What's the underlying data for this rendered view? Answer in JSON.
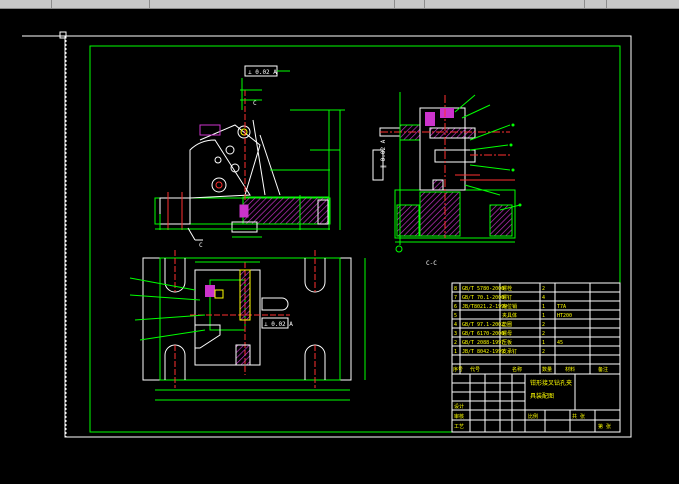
{
  "window": {
    "title_strip": "",
    "strip_colors": {
      "bg": "#c8c8c8",
      "divider": "#8c8c8c"
    }
  },
  "colors": {
    "background": "#000000",
    "border_green": "#00ff00",
    "white": "#ffffff",
    "red": "#ff3030",
    "yellow": "#ffff00",
    "magenta": "#cc33cc",
    "cyan": "#00ffff"
  },
  "drawing": {
    "section_label": "C-C",
    "view_marker": "C",
    "tag_top": "⊥ 0.02 A",
    "tag_side": "∥ 0.02 A",
    "tag_plan": "⊥ 0.02 A"
  },
  "bom": {
    "rows": [
      {
        "no": "8",
        "code": "GB/T 5780-2000",
        "name": "螺栓",
        "qty": "2"
      },
      {
        "no": "7",
        "code": "GB/T 70.1-2000",
        "name": "螺钉",
        "qty": "4"
      },
      {
        "no": "6",
        "code": "JB/T8021.2-1999",
        "name": "定位销",
        "qty": "1",
        "mat": "T7A"
      },
      {
        "no": "5",
        "code": "",
        "name": "夹具体",
        "qty": "1",
        "mat": "HT200"
      },
      {
        "no": "4",
        "code": "GB/T 97.1-2002",
        "name": "垫圈",
        "qty": "2"
      },
      {
        "no": "3",
        "code": "GB/T 6170-2000",
        "name": "螺母",
        "qty": "2"
      },
      {
        "no": "2",
        "code": "GB/T 2088-1997",
        "name": "压板",
        "qty": "1",
        "mat": "45"
      },
      {
        "no": "1",
        "code": "JB/T 8042-1999",
        "name": "支承钉",
        "qty": "2"
      }
    ],
    "header_labels": [
      "序号",
      "代号",
      "名称",
      "数量",
      "材料",
      "备注"
    ],
    "title_line1": "钳形接叉钻孔夹",
    "title_line2": "具装配图",
    "meta_labels": [
      "设计",
      "审核",
      "工艺",
      "比例",
      "共 张",
      "第 张"
    ]
  }
}
